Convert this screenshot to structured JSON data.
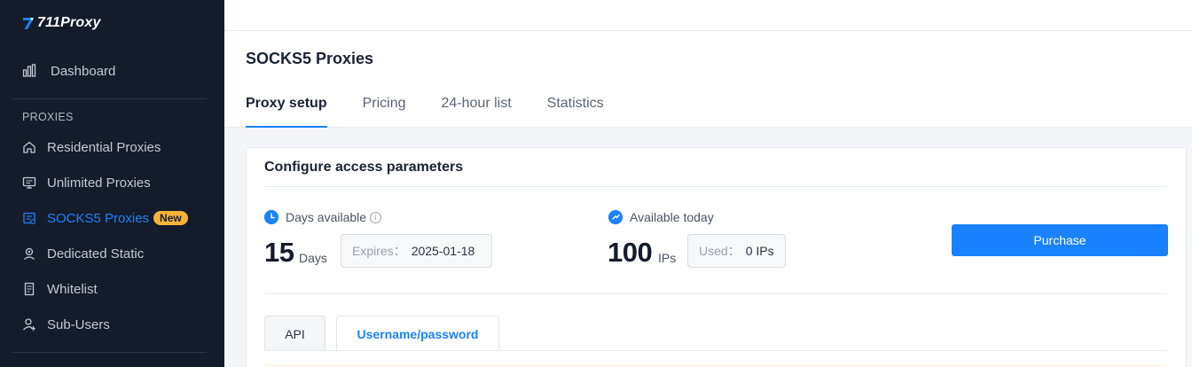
{
  "brand": {
    "name": "711Proxy"
  },
  "sidebar": {
    "dashboard_label": "Dashboard",
    "section_label": "PROXIES",
    "items": [
      {
        "label": "Residential Proxies",
        "icon": "home-icon"
      },
      {
        "label": "Unlimited Proxies",
        "icon": "monitor-icon"
      },
      {
        "label": "SOCKS5 Proxies",
        "icon": "socks-icon",
        "badge": "New",
        "active": true
      },
      {
        "label": "Dedicated Static",
        "icon": "user-location-icon"
      },
      {
        "label": "Whitelist",
        "icon": "document-icon"
      },
      {
        "label": "Sub-Users",
        "icon": "add-user-icon"
      }
    ]
  },
  "page": {
    "title": "SOCKS5 Proxies",
    "tabs": [
      "Proxy setup",
      "Pricing",
      "24-hour list",
      "Statistics"
    ],
    "active_tab": "Proxy setup"
  },
  "card": {
    "title": "Configure access parameters",
    "days": {
      "label": "Days available",
      "value": "15",
      "unit": "Days",
      "expires_key": "Expires：",
      "expires_value": "2025-01-18"
    },
    "today": {
      "label": "Available today",
      "value": "100",
      "unit": "IPs",
      "used_key": "Used：",
      "used_value": "0 IPs"
    },
    "purchase_label": "Purchase",
    "subtabs": [
      "API",
      "Username/password"
    ],
    "active_subtab": "Username/password"
  },
  "colors": {
    "accent": "#1a82ff",
    "sidebar_bg": "#141c2b",
    "badge": "#f5b33a"
  }
}
